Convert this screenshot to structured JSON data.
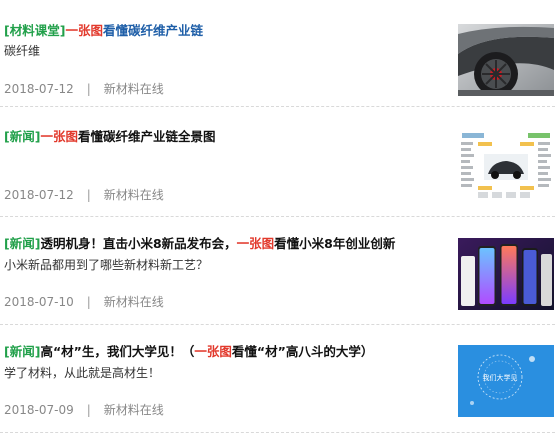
{
  "articles": [
    {
      "tag": "[材料课堂]",
      "title_red": "一张图",
      "title_rest": "看懂碳纤维产业链",
      "summary": "碳纤维",
      "date": "2018-07-12",
      "separator": "|",
      "source": "新材料在线"
    },
    {
      "tag": "[新闻]",
      "title_red": "一张图",
      "title_rest": "看懂碳纤维产业链全景图",
      "summary": "",
      "date": "2018-07-12",
      "separator": "|",
      "source": "新材料在线"
    },
    {
      "tag": "[新闻]",
      "title_pre": "透明机身！直击小米8新品发布会，",
      "title_red": "一张图",
      "title_rest": "看懂小米8年创业创新",
      "summary": "小米新品都用到了哪些新材料新工艺？",
      "date": "2018-07-10",
      "separator": "|",
      "source": "新材料在线"
    },
    {
      "tag": "[新闻]",
      "title_pre": "高“材”生，我们大学见！（",
      "title_red": "一张图",
      "title_rest": "看懂“材”高八斗的大学）",
      "summary": "学了材料，从此就是高材生！",
      "date": "2018-07-09",
      "separator": "|",
      "source": "新材料在线"
    }
  ],
  "thumb_text": {
    "campus": "我们大学见"
  },
  "colors": {
    "tag": "#21a04a",
    "highlight": "#e2392c",
    "link_blue": "#1f5fa8",
    "meta": "#888888"
  }
}
